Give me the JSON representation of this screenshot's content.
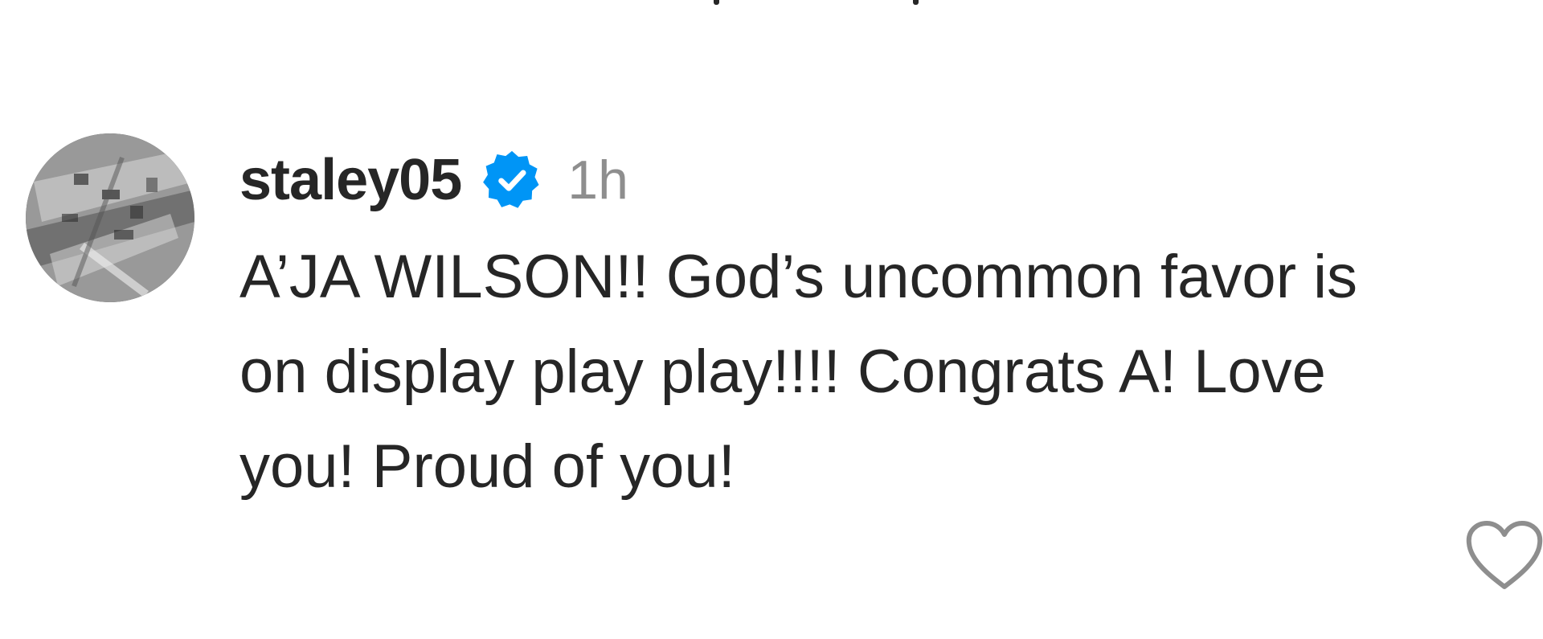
{
  "comment": {
    "username": "staley05",
    "verified": true,
    "timestamp": "1h",
    "text": "A’JA WILSON!! God’s uncommon favor is on display play play!!!! Congrats A! Love you! Proud of you!"
  },
  "icons": {
    "verified": "verified-badge-icon",
    "like": "heart-outline-icon"
  },
  "colors": {
    "verified_blue": "#0095F6",
    "text_primary": "#262626",
    "text_secondary": "#8E8E8E",
    "like_outline": "#8E8E8E"
  }
}
